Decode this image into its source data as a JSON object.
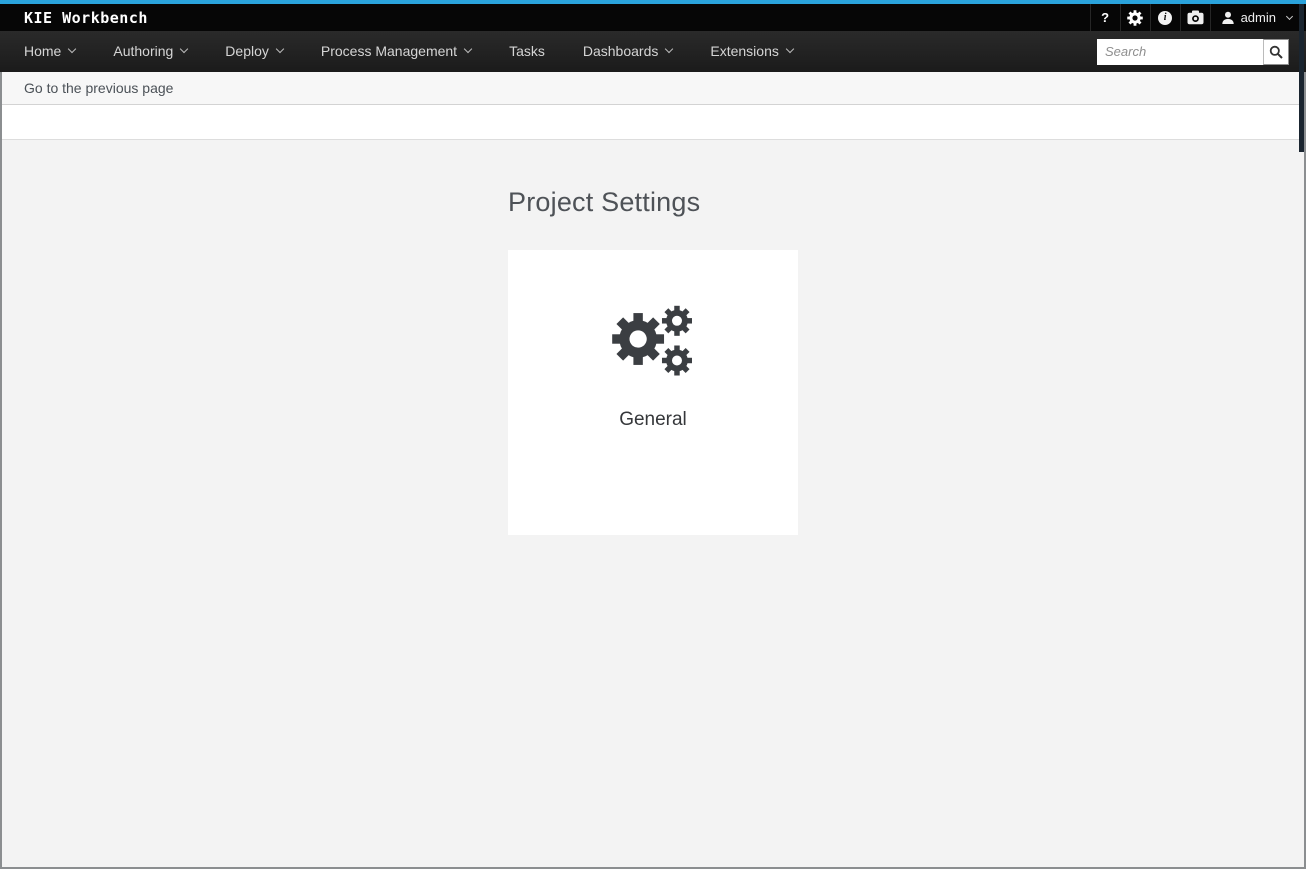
{
  "masthead": {
    "brand": "KIE Workbench",
    "utility": {
      "help_glyph": "?",
      "info_glyph": "i",
      "user": {
        "name": "admin"
      }
    }
  },
  "navbar": {
    "items": [
      {
        "label": "Home",
        "has_dropdown": true
      },
      {
        "label": "Authoring",
        "has_dropdown": true
      },
      {
        "label": "Deploy",
        "has_dropdown": true
      },
      {
        "label": "Process Management",
        "has_dropdown": true
      },
      {
        "label": "Tasks",
        "has_dropdown": false
      },
      {
        "label": "Dashboards",
        "has_dropdown": true
      },
      {
        "label": "Extensions",
        "has_dropdown": true
      }
    ],
    "search": {
      "placeholder": "Search"
    }
  },
  "breadcrumb": {
    "back_label": "Go to the previous page"
  },
  "main": {
    "title": "Project Settings",
    "cards": [
      {
        "label": "General",
        "icon": "gears-icon"
      }
    ]
  },
  "colors": {
    "accent_blue": "#2aa3dc",
    "masthead_bg": "#060606",
    "navbar_bg": "#1f1f1f",
    "content_bg": "#f3f3f3",
    "card_bg": "#ffffff",
    "icon_dark": "#3b3e42",
    "title_text": "#4e5257",
    "frame_border": "#8b8e90"
  }
}
